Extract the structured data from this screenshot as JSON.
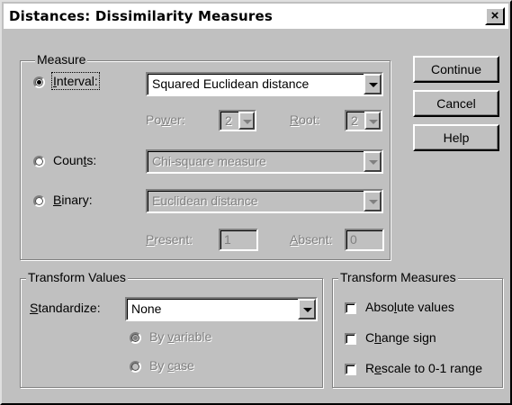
{
  "window": {
    "title": "Distances: Dissimilarity Measures",
    "close_glyph": "×"
  },
  "measure": {
    "legend": "Measure",
    "interval": {
      "label": "Interval:",
      "selected": true,
      "combo_value": "Squared Euclidean distance"
    },
    "power": {
      "label": "Power:",
      "value": "2"
    },
    "root": {
      "label": "Root:",
      "value": "2"
    },
    "counts": {
      "label": "Counts:",
      "selected": false,
      "combo_value": "Chi-square measure"
    },
    "binary": {
      "label": "Binary:",
      "selected": false,
      "combo_value": "Euclidean distance"
    },
    "present": {
      "label": "Present:",
      "value": "1"
    },
    "absent": {
      "label": "Absent:",
      "value": "0"
    }
  },
  "buttons": {
    "continue": "Continue",
    "cancel": "Cancel",
    "help": "Help"
  },
  "transform_values": {
    "legend": "Transform Values",
    "standardize_label": "Standardize:",
    "standardize_value": "None",
    "by_variable": "By variable",
    "by_case": "By case"
  },
  "transform_measures": {
    "legend": "Transform Measures",
    "absolute": "Absolute values",
    "change_sign": "Change sign",
    "rescale": "Rescale to 0-1 range"
  },
  "icons": {
    "dropdown": "chevron-down-icon",
    "close": "close-icon"
  }
}
